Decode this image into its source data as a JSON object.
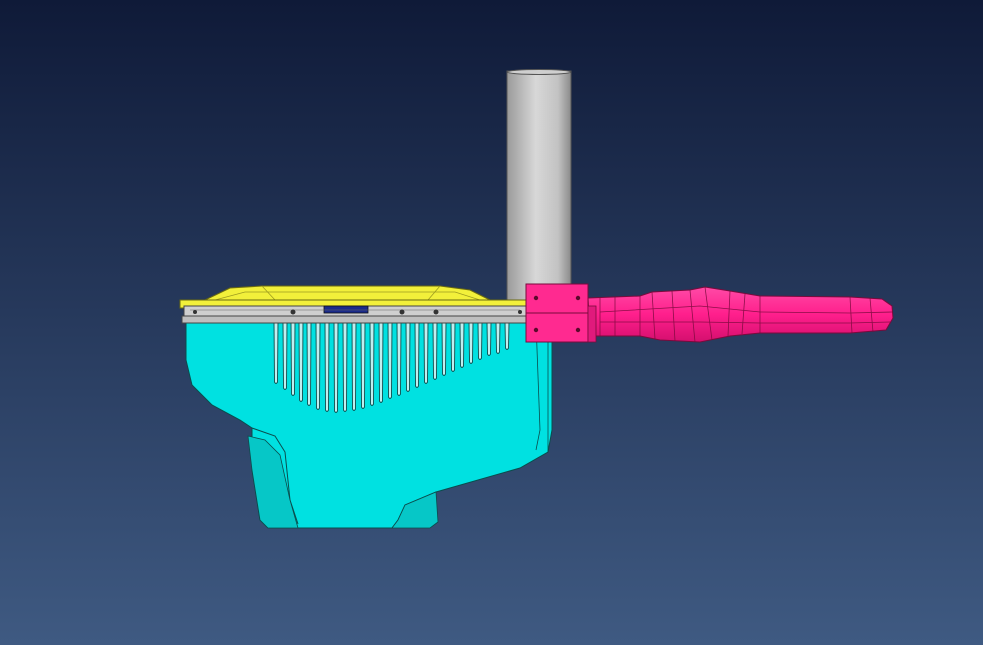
{
  "viewport": {
    "background_top": "#0f1a38",
    "background_bottom": "#3f5a82"
  },
  "model": {
    "housing_color": "#00e1e1",
    "lid_color": "#f2f03a",
    "arm_color": "#ff1f8c",
    "bracket_color": "#ff2a90",
    "pole_color": "#b8b8b8",
    "rail_color": "#c9c9c9"
  }
}
